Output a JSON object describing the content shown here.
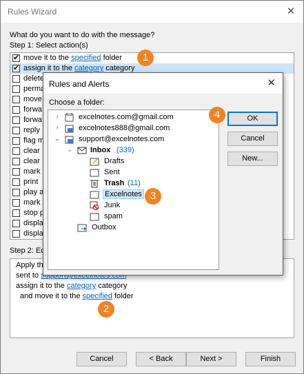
{
  "window": {
    "title": "Rules Wizard",
    "close_glyph": "✕"
  },
  "wizard": {
    "question": "What do you want to do with the message?",
    "step1_label": "Step 1: Select action(s)",
    "actions": [
      {
        "pre": "move it to the ",
        "link": "specified",
        "post": " folder",
        "checked": true
      },
      {
        "pre": "assign it to the ",
        "link": "category",
        "post": " category",
        "checked": true
      },
      {
        "pre": "delete",
        "link": "",
        "post": "",
        "checked": false
      },
      {
        "pre": "perma",
        "link": "",
        "post": "",
        "checked": false
      },
      {
        "pre": "move",
        "link": "",
        "post": "",
        "checked": false
      },
      {
        "pre": "forwa",
        "link": "",
        "post": "",
        "checked": false
      },
      {
        "pre": "forwa",
        "link": "",
        "post": "",
        "checked": false
      },
      {
        "pre": "reply",
        "link": "",
        "post": "",
        "checked": false
      },
      {
        "pre": "flag m",
        "link": "",
        "post": "",
        "checked": false
      },
      {
        "pre": "clear",
        "link": "",
        "post": "",
        "checked": false
      },
      {
        "pre": "clear",
        "link": "",
        "post": "",
        "checked": false
      },
      {
        "pre": "mark",
        "link": "",
        "post": "",
        "checked": false
      },
      {
        "pre": "print",
        "link": "",
        "post": "",
        "checked": false
      },
      {
        "pre": "play a",
        "link": "",
        "post": "",
        "checked": false
      },
      {
        "pre": "mark",
        "link": "",
        "post": "",
        "checked": false
      },
      {
        "pre": "stop p",
        "link": "",
        "post": "",
        "checked": false
      },
      {
        "pre": "displa",
        "link": "",
        "post": "",
        "checked": false
      },
      {
        "pre": "displa",
        "link": "",
        "post": "",
        "checked": false
      }
    ],
    "step2_label": "Step 2: Ed",
    "desc_line1": "Apply th",
    "desc_line2_pre": "sent to ",
    "desc_line2_link": "support@excelnotes.com",
    "desc_line3_pre": "assign it to the ",
    "desc_line3_link": "category",
    "desc_line3_post": " category",
    "desc_line4_pre": "and move it to the ",
    "desc_line4_link": "specified",
    "desc_line4_post": " folder",
    "buttons": {
      "cancel": "Cancel",
      "back": "< Back",
      "next": "Next >",
      "finish": "Finish"
    }
  },
  "dialog": {
    "title": "Rules and Alerts",
    "close_glyph": "✕",
    "choose_label": "Choose a folder:",
    "tree": {
      "account1": "excelnotes.com@gmail.com",
      "account2": "excelnotes888@gmail.com",
      "account3": "support@excelnotes.com",
      "inbox": "Inbox",
      "inbox_count": "(339)",
      "drafts": "Drafts",
      "sent": "Sent",
      "trash": "Trash",
      "trash_count": "(11)",
      "excelnotes": "Excelnotes",
      "junk": "Junk",
      "spam": "spam",
      "outbox": "Outbox"
    },
    "buttons": {
      "ok": "OK",
      "cancel": "Cancel",
      "new": "New..."
    }
  },
  "badges": {
    "b1": "1",
    "b2": "2",
    "b3": "3",
    "b4": "4"
  },
  "colors": {
    "badge": "#f58220",
    "link": "#0563c1",
    "selection": "#3399ff"
  }
}
